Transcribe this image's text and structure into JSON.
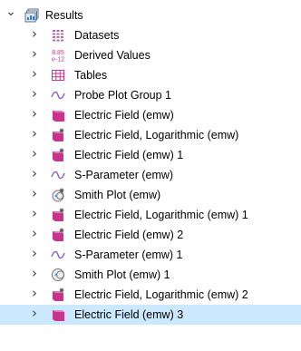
{
  "tree": {
    "root": {
      "label": "Results",
      "icon": "results-folder-icon",
      "expanded": true
    },
    "items": [
      {
        "label": "Datasets",
        "icon": "datasets-icon"
      },
      {
        "label": "Derived Values",
        "icon": "derived-values-icon",
        "icon_text_top": "8.85",
        "icon_text_bottom": "e-12"
      },
      {
        "label": "Tables",
        "icon": "table-icon"
      },
      {
        "label": "Probe Plot Group 1",
        "icon": "wave-plot-icon"
      },
      {
        "label": "Electric Field (emw)",
        "icon": "3d-plot-icon"
      },
      {
        "label": "Electric Field, Logarithmic (emw)",
        "icon": "3d-plot-star-icon"
      },
      {
        "label": "Electric Field (emw) 1",
        "icon": "3d-plot-star-icon"
      },
      {
        "label": "S-Parameter (emw)",
        "icon": "wave-plot-icon"
      },
      {
        "label": "Smith Plot (emw)",
        "icon": "smith-plot-star-icon"
      },
      {
        "label": "Electric Field, Logarithmic (emw) 1",
        "icon": "3d-plot-star-icon"
      },
      {
        "label": "Electric Field (emw) 2",
        "icon": "3d-plot-star-icon"
      },
      {
        "label": "S-Parameter (emw) 1",
        "icon": "wave-plot-icon"
      },
      {
        "label": "Smith Plot (emw) 1",
        "icon": "smith-plot-icon"
      },
      {
        "label": "Electric Field, Logarithmic (emw) 2",
        "icon": "3d-plot-star-icon"
      },
      {
        "label": "Electric Field (emw) 3",
        "icon": "3d-plot-icon",
        "selected": true
      }
    ]
  },
  "colors": {
    "selection": "#cce8ff",
    "plot_magenta": "#c7348c",
    "wave_purple": "#8a5bc7",
    "datasets_purple": "#b06ab0"
  }
}
